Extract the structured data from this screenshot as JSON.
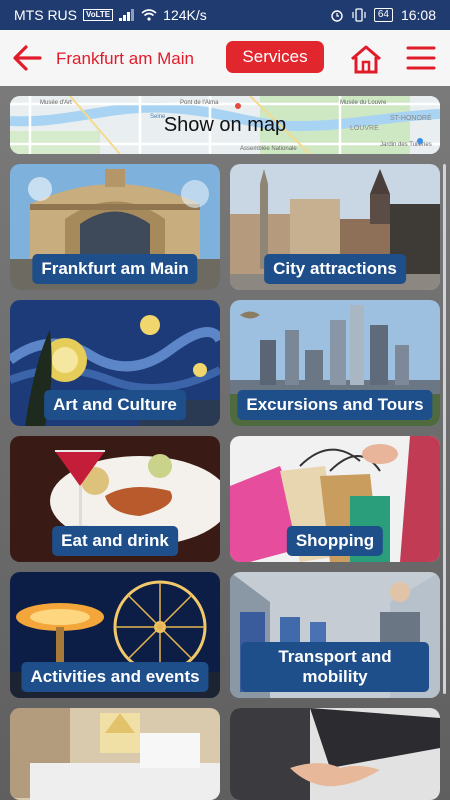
{
  "status_bar": {
    "carrier": "MTS RUS",
    "volte": "VoLTE",
    "speed": "124K/s",
    "battery": "64",
    "time": "16:08"
  },
  "header": {
    "title": "Frankfurt am Main",
    "services_label": "Services"
  },
  "map": {
    "label": "Show on map",
    "place_labels": [
      "Musée d'Art",
      "Pont de l'Alma",
      "Seine",
      "Musée du Louvre",
      "ST-HONORÉ",
      "LOUVRE",
      "Jardin des Tuileries",
      "Assemblée Nationale"
    ]
  },
  "tiles": [
    {
      "label": "Frankfurt am Main"
    },
    {
      "label": "City attractions"
    },
    {
      "label": "Art and Culture"
    },
    {
      "label": "Excursions and Tours"
    },
    {
      "label": "Eat and drink"
    },
    {
      "label": "Shopping"
    },
    {
      "label": "Activities and events"
    },
    {
      "label": "Transport and mobility"
    }
  ],
  "colors": {
    "status_bar": "#1f3b70",
    "accent_red": "#e11c2a",
    "label_blue": "#1f4f8a"
  }
}
